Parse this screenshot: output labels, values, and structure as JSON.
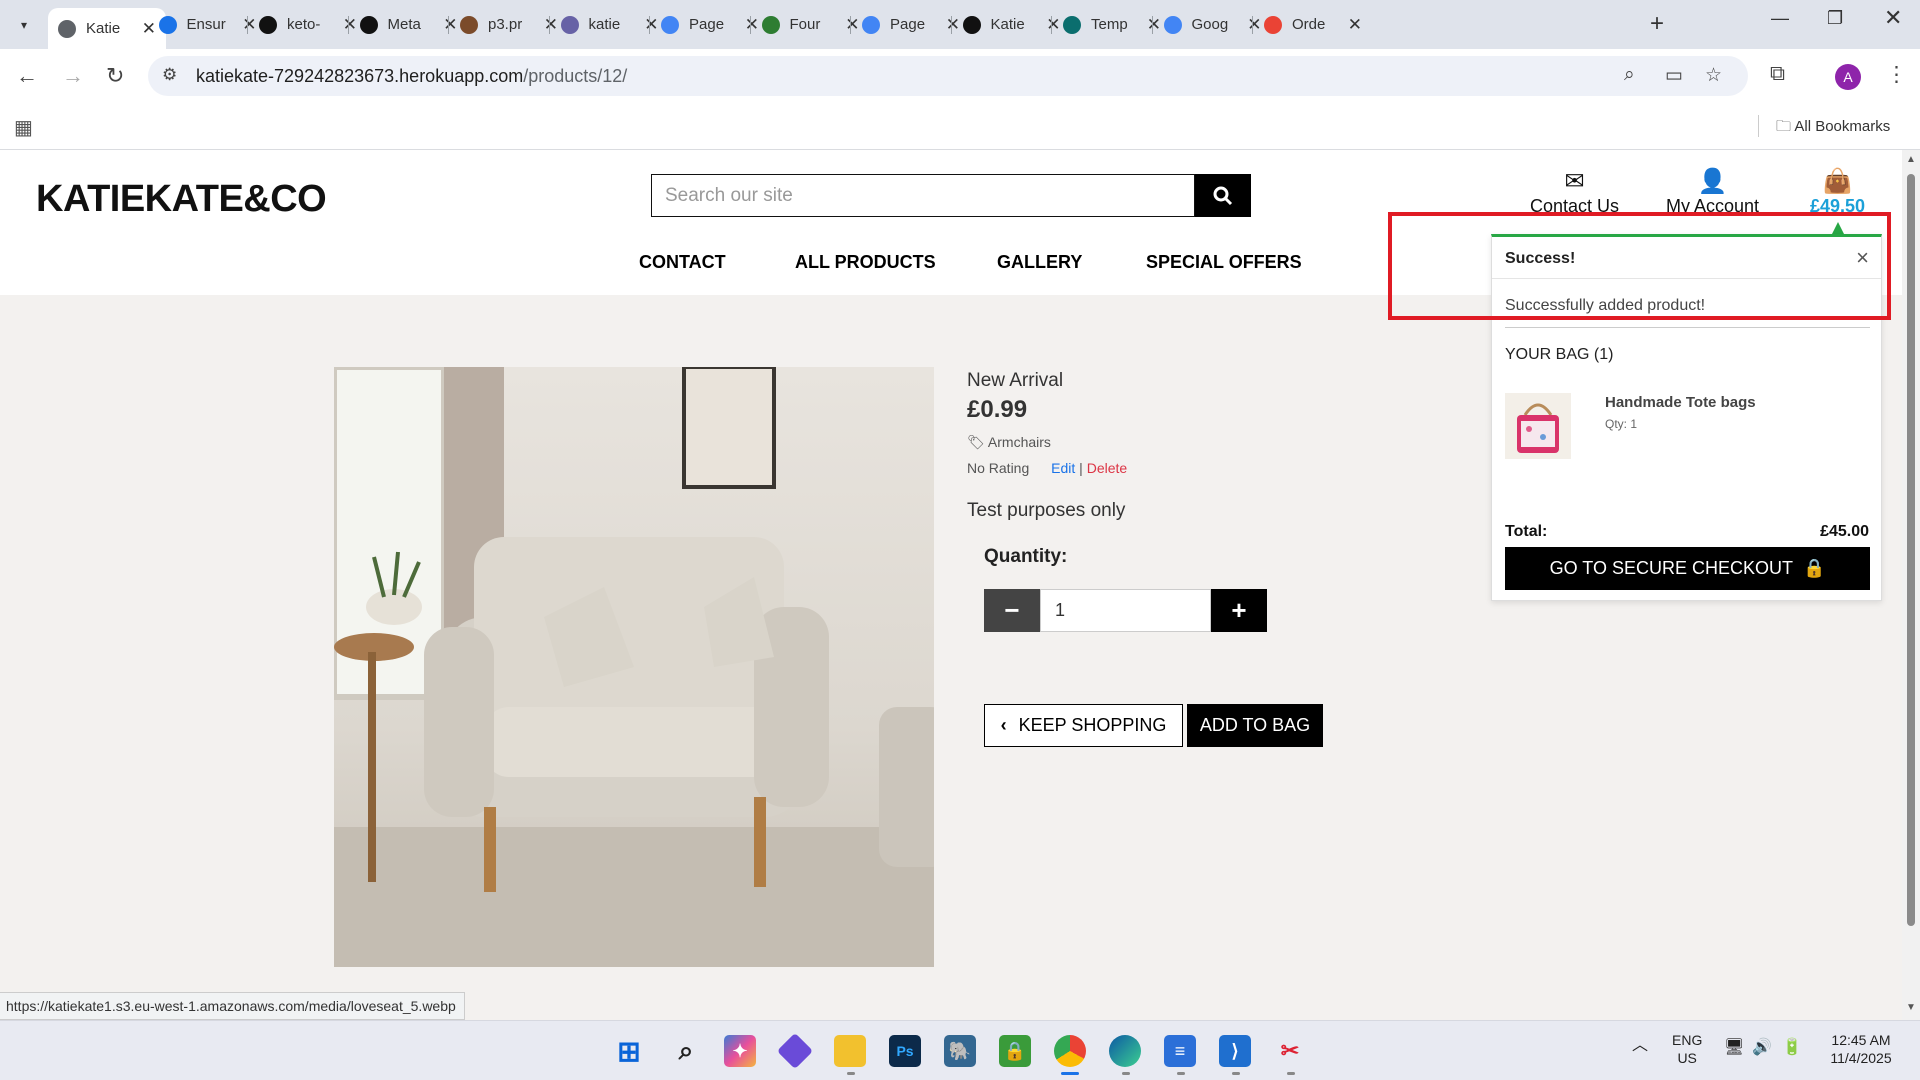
{
  "browser": {
    "tabs": [
      {
        "label": "Katie",
        "icon": "globe-icon",
        "color": "#5f6368",
        "active": true
      },
      {
        "label": "Ensur",
        "icon": "chrome-icon",
        "color": "#1a73e8"
      },
      {
        "label": "keto-",
        "icon": "github-icon",
        "color": "#111111"
      },
      {
        "label": "Meta",
        "icon": "openai-icon",
        "color": "#111111"
      },
      {
        "label": "p3.pr",
        "icon": "p3-icon",
        "color": "#7b4b2a"
      },
      {
        "label": "katie",
        "icon": "heroku-icon",
        "color": "#6762a6"
      },
      {
        "label": "Page",
        "icon": "pagespeed-icon",
        "color": "#4285f4"
      },
      {
        "label": "Four",
        "icon": "earth-icon",
        "color": "#2e7d32"
      },
      {
        "label": "Page",
        "icon": "pagespeed-icon",
        "color": "#4285f4"
      },
      {
        "label": "Katie",
        "icon": "github-icon",
        "color": "#111111"
      },
      {
        "label": "Temp",
        "icon": "template-icon",
        "color": "#0b6e6e"
      },
      {
        "label": "Goog",
        "icon": "google-key-icon",
        "color": "#4285f4"
      },
      {
        "label": "Orde",
        "icon": "gmail-icon",
        "color": "#ea4335"
      }
    ],
    "url_domain": "katiekate-729242823673.herokuapp.com",
    "url_path": "/products/12/",
    "profile_initial": "A",
    "all_bookmarks": "All Bookmarks",
    "status_url": "https://katiekate1.s3.eu-west-1.amazonaws.com/media/loveseat_5.webp"
  },
  "site": {
    "logo": "KATIEKATE&CO",
    "search_placeholder": "Search our site",
    "header_links": {
      "contact": "Contact Us",
      "account": "My Account",
      "bag_total": "£49.50"
    },
    "nav": [
      "CONTACT",
      "ALL PRODUCTS",
      "GALLERY",
      "SPECIAL OFFERS"
    ]
  },
  "product": {
    "name": "New Arrival",
    "price": "£0.99",
    "category": "Armchairs",
    "rating": "No Rating",
    "edit": "Edit",
    "separator": "|",
    "delete": "Delete",
    "description": "Test purposes only",
    "quantity_label": "Quantity:",
    "quantity_value": "1",
    "keep_shopping": "KEEP SHOPPING",
    "add_to_bag": "ADD TO BAG"
  },
  "toast": {
    "title": "Success!",
    "message": "Successfully added product!",
    "bag_title": "YOUR BAG (1)",
    "item_name": "Handmade Tote bags",
    "item_qty": "Qty: 1",
    "total_label": "Total:",
    "total_value": "£45.00",
    "checkout": "GO TO SECURE CHECKOUT",
    "accent_color": "#28a745"
  },
  "taskbar": {
    "lang_top": "ENG",
    "lang_bottom": "US",
    "time": "12:45 AM",
    "date": "11/4/2025"
  }
}
